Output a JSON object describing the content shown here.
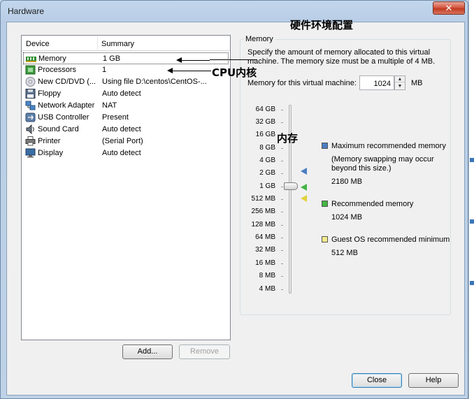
{
  "window": {
    "title": "Hardware",
    "close_glyph": "✕"
  },
  "device_list": {
    "columns": {
      "device": "Device",
      "summary": "Summary"
    },
    "rows": [
      {
        "device": "Memory",
        "summary": "1 GB",
        "icon": "memory-icon"
      },
      {
        "device": "Processors",
        "summary": "1",
        "icon": "processor-icon"
      },
      {
        "device": "New CD/DVD (...",
        "summary": "Using file D:\\centos\\CentOS-...",
        "icon": "cd-dvd-icon"
      },
      {
        "device": "Floppy",
        "summary": "Auto detect",
        "icon": "floppy-icon"
      },
      {
        "device": "Network Adapter",
        "summary": "NAT",
        "icon": "network-adapter-icon"
      },
      {
        "device": "USB Controller",
        "summary": "Present",
        "icon": "usb-icon"
      },
      {
        "device": "Sound Card",
        "summary": "Auto detect",
        "icon": "sound-card-icon"
      },
      {
        "device": "Printer",
        "summary": "(Serial Port)",
        "icon": "printer-icon"
      },
      {
        "device": "Display",
        "summary": "Auto detect",
        "icon": "display-icon"
      }
    ],
    "add_label": "Add...",
    "remove_label": "Remove"
  },
  "memory_panel": {
    "group_label": "Memory",
    "description": "Specify the amount of memory allocated to this virtual machine. The memory size must be a multiple of 4 MB.",
    "field_label": "Memory for this virtual machine:",
    "value": "1024",
    "unit": "MB",
    "scale": [
      "64 GB",
      "32 GB",
      "16 GB",
      "8 GB",
      "4 GB",
      "2 GB",
      "1 GB",
      "512 MB",
      "256 MB",
      "128 MB",
      "64 MB",
      "32 MB",
      "16 MB",
      "8 MB",
      "4 MB"
    ],
    "legend": {
      "max_label": "Maximum recommended memory",
      "max_note": "(Memory swapping may occur beyond this size.)",
      "max_value": "2180 MB",
      "rec_label": "Recommended memory",
      "rec_value": "1024 MB",
      "min_label": "Guest OS recommended minimum",
      "min_value": "512 MB"
    },
    "colors": {
      "max": "#4a7ec2",
      "recommended": "#44b544",
      "minimum": "#e3d23a"
    }
  },
  "footer": {
    "close_label": "Close",
    "help_label": "Help"
  },
  "annotations": {
    "hardware_config": "硬件环境配置",
    "cpu_cores": "CPU内核",
    "memory": "内存"
  }
}
